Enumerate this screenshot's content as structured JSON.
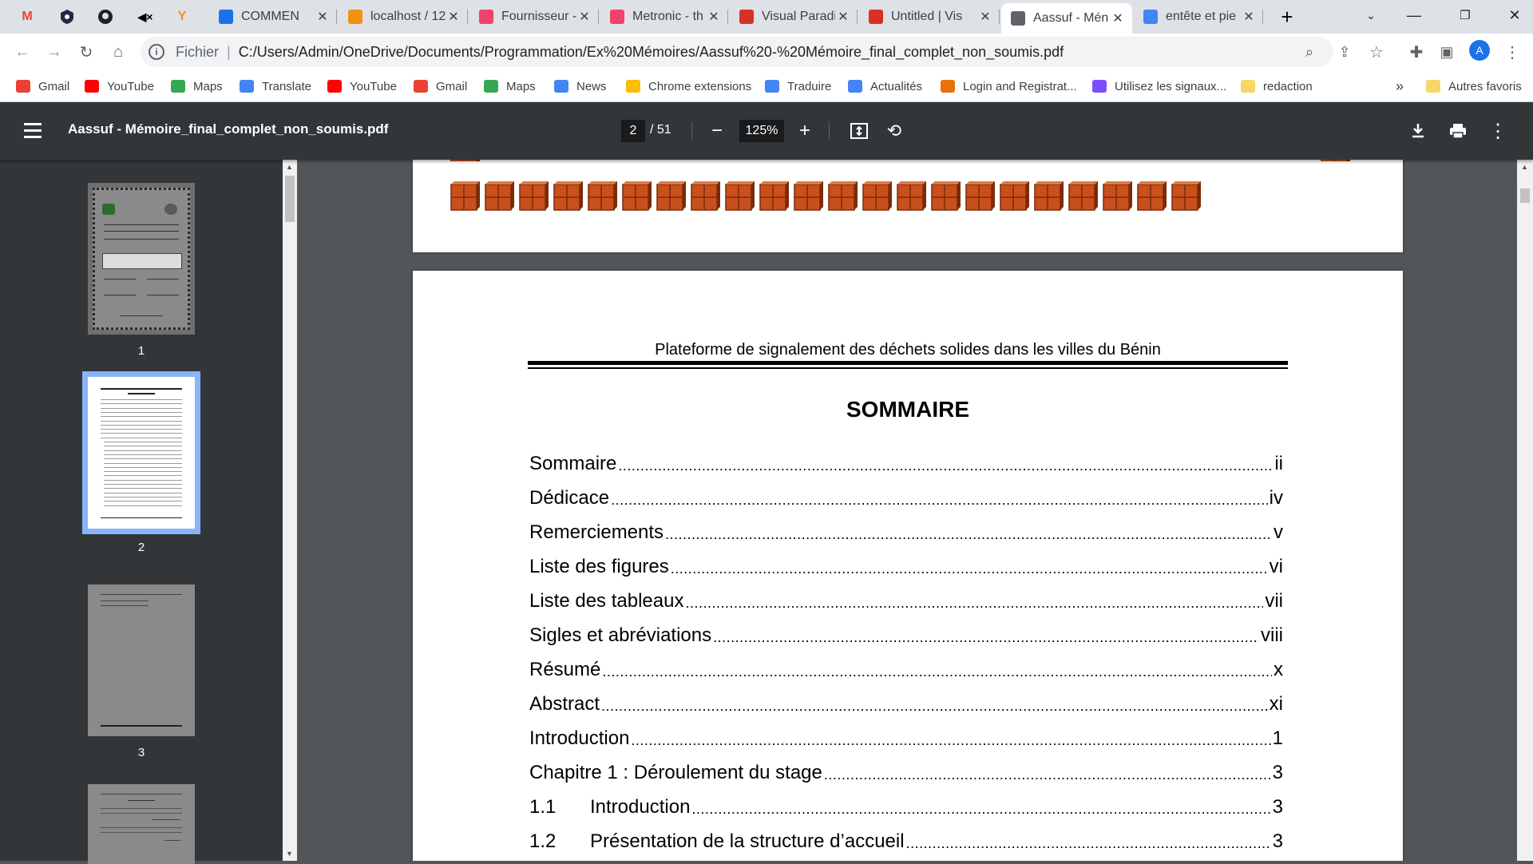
{
  "browser": {
    "pinned_tabs": [
      "M",
      "shield",
      "github",
      "audio",
      "fork"
    ],
    "tabs": [
      {
        "title": "COMMEN",
        "icon": "pulse-icon",
        "color": "#1a73e8"
      },
      {
        "title": "localhost / 12",
        "icon": "phpmyadmin-icon",
        "color": "#f29111"
      },
      {
        "title": "Fournisseur -",
        "icon": "metronic-icon",
        "color": "#f1416c"
      },
      {
        "title": "Metronic - th",
        "icon": "metronic-icon",
        "color": "#f1416c"
      },
      {
        "title": "Visual Paradi",
        "icon": "visual-paradigm-icon",
        "color": "#d93025"
      },
      {
        "title": "Untitled | Vis",
        "icon": "visual-paradigm-icon",
        "color": "#d93025"
      },
      {
        "title": "Aassuf - Mén",
        "icon": "globe-icon",
        "color": "#5f6368"
      },
      {
        "title": "entête et pie",
        "icon": "google-icon",
        "color": "#4285f4"
      }
    ],
    "address": {
      "label": "Fichier",
      "url": "C:/Users/Admin/OneDrive/Documents/Programmation/Ex%20Mémoires/Aassuf%20-%20Mémoire_final_complet_non_soumis.pdf"
    },
    "profile_initial": "A",
    "bookmarks": [
      {
        "label": "Gmail",
        "icon": "gmail-icon",
        "color": "#ea4335"
      },
      {
        "label": "YouTube",
        "icon": "youtube-icon",
        "color": "#ff0000"
      },
      {
        "label": "Maps",
        "icon": "maps-icon",
        "color": "#34a853"
      },
      {
        "label": "Translate",
        "icon": "translate-icon",
        "color": "#4285f4"
      },
      {
        "label": "YouTube",
        "icon": "youtube-icon",
        "color": "#ff0000"
      },
      {
        "label": "Gmail",
        "icon": "gmail-icon",
        "color": "#ea4335"
      },
      {
        "label": "Maps",
        "icon": "maps-icon",
        "color": "#34a853"
      },
      {
        "label": "News",
        "icon": "news-icon",
        "color": "#4285f4"
      },
      {
        "label": "Chrome extensions",
        "icon": "chrome-icon",
        "color": "#fbbc04"
      },
      {
        "label": "Traduire",
        "icon": "translate-icon",
        "color": "#4285f4"
      },
      {
        "label": "Actualités",
        "icon": "news-icon",
        "color": "#4285f4"
      },
      {
        "label": "Login and Registrat...",
        "icon": "login-icon",
        "color": "#e8710a"
      },
      {
        "label": "Utilisez les signaux...",
        "icon": "signals-icon",
        "color": "#7c4dff"
      },
      {
        "label": "redaction",
        "icon": "folder-icon",
        "color": "#f9d66a"
      }
    ],
    "overflow": "»",
    "other_bookmarks": "Autres favoris"
  },
  "pdf": {
    "title": "Aassuf - Mémoire_final_complet_non_soumis.pdf",
    "current_page": "2",
    "total_pages": "/ 51",
    "zoom": "125%",
    "thumbnails": [
      "1",
      "2",
      "3"
    ],
    "header_text": "Plateforme de signalement des déchets solides dans les villes du Bénin",
    "heading": "SOMMAIRE",
    "toc": [
      {
        "num": "",
        "label": "Sommaire",
        "page": "ii"
      },
      {
        "num": "",
        "label": "Dédicace",
        "page": "iv"
      },
      {
        "num": "",
        "label": "Remerciements",
        "page": "v"
      },
      {
        "num": "",
        "label": "Liste des figures",
        "page": "vi"
      },
      {
        "num": "",
        "label": "Liste des tableaux",
        "page": "vii"
      },
      {
        "num": "",
        "label": "Sigles et abréviations",
        "page": "viii"
      },
      {
        "num": "",
        "label": "Résumé",
        "page": "x"
      },
      {
        "num": "",
        "label": "Abstract",
        "page": "xi"
      },
      {
        "num": "",
        "label": "Introduction",
        "page": "1"
      },
      {
        "num": "",
        "label": "Chapitre 1 : Déroulement du stage",
        "page": "3"
      },
      {
        "num": "1.1",
        "label": "Introduction",
        "page": "3"
      },
      {
        "num": "1.2",
        "label": "Présentation de la structure d’accueil",
        "page": "3"
      }
    ]
  },
  "colors": {
    "brick": "#c9501c",
    "brick_dark": "#7a2a08",
    "chrome_bg": "#dee1e6",
    "pdf_bar": "#323639"
  }
}
